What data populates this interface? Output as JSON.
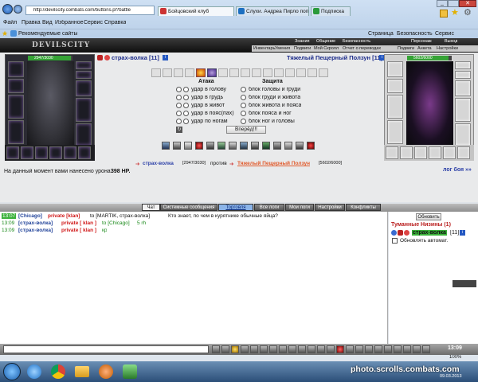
{
  "browser": {
    "address": "http://devilscity.combats.com/buttons.pl?battle",
    "tabs": [
      {
        "label": "Бойцовский клуб"
      },
      {
        "label": "Слухи. Андреа Пирло попал ..."
      },
      {
        "label": "Подписка"
      }
    ],
    "menu": [
      "Файл",
      "Правка",
      "Вид",
      "Избранное",
      "Сервис",
      "Справка"
    ],
    "favorites": "Рекомендуемые сайты",
    "right_tools": [
      "Страница",
      "Безопасность",
      "Сервис"
    ]
  },
  "game": {
    "logo": "DEVILSCITY",
    "nav_top": [
      "Знания",
      "Общение",
      "Безопасность",
      "Персонаж",
      "Выход"
    ],
    "nav_bottom": [
      "Инвентарь",
      "Умения",
      "Подвиги",
      "Мой Скролл",
      "Отчет о переводах",
      "Подвиги",
      "Анкета",
      "Настройки"
    ],
    "player": {
      "name": "страх-волка [11]",
      "hp": "2947/3030",
      "hp_frac": 0.97
    },
    "enemy": {
      "name": "Тяжелый Пещерный Ползун [11]",
      "hp": "5602/6000",
      "hp_frac": 0.93
    },
    "attack_header": "Атака",
    "defense_header": "Защита",
    "attacks": [
      "удар в голову",
      "удар в грудь",
      "удар в живот",
      "удар в пояс(пах)",
      "удар по ногам"
    ],
    "blocks": [
      "блок головы и груди",
      "блок груди и живота",
      "блок живота и пояса",
      "блок пояса и ног",
      "блок ног и головы"
    ],
    "forward_button": "Вперёд!!!",
    "vs_player": "страх-волка",
    "vs_player_hp": "[2947/3030]",
    "vs_word": "против",
    "vs_enemy": "Тяжелый Пещерный Ползун",
    "vs_enemy_hp": "[5602/6000]",
    "damage_prefix": "На данный момент вами нанесено урона:",
    "damage_value": "398 HP.",
    "battle_log_link": "лог боя »»"
  },
  "chat": {
    "tabs": [
      "Чат",
      "Системные сообщения",
      "Торговля",
      "Все логи",
      "Мои логи",
      "Настройки",
      "Конфликты"
    ],
    "messages": [
      {
        "time": "13:07",
        "channel": "[Chicago]",
        "from": "private [klan]",
        "to": "to [MARTIK, страх-волка]",
        "text": "Кто знает, по чем в курятнике обычные яйца?"
      },
      {
        "time": "13:09",
        "channel": "[страх-волка]",
        "from": "private [ klan ]",
        "to": "to [Chicago]",
        "text": "5 rh"
      },
      {
        "time": "13:09",
        "channel": "[страх-волка]",
        "from": "private [ klan ]",
        "to": "",
        "text": "кр"
      }
    ]
  },
  "side": {
    "refresh_button": "Обновить",
    "location": "Туманные Низины (1)",
    "user": "страх-волка",
    "user_level": "[11]",
    "auto_refresh": "Обновлять автомат."
  },
  "status": {
    "zoom": "100%",
    "time": "13:09",
    "date": "09.03.2013"
  },
  "watermark": "photo.scrolls.combats.com"
}
